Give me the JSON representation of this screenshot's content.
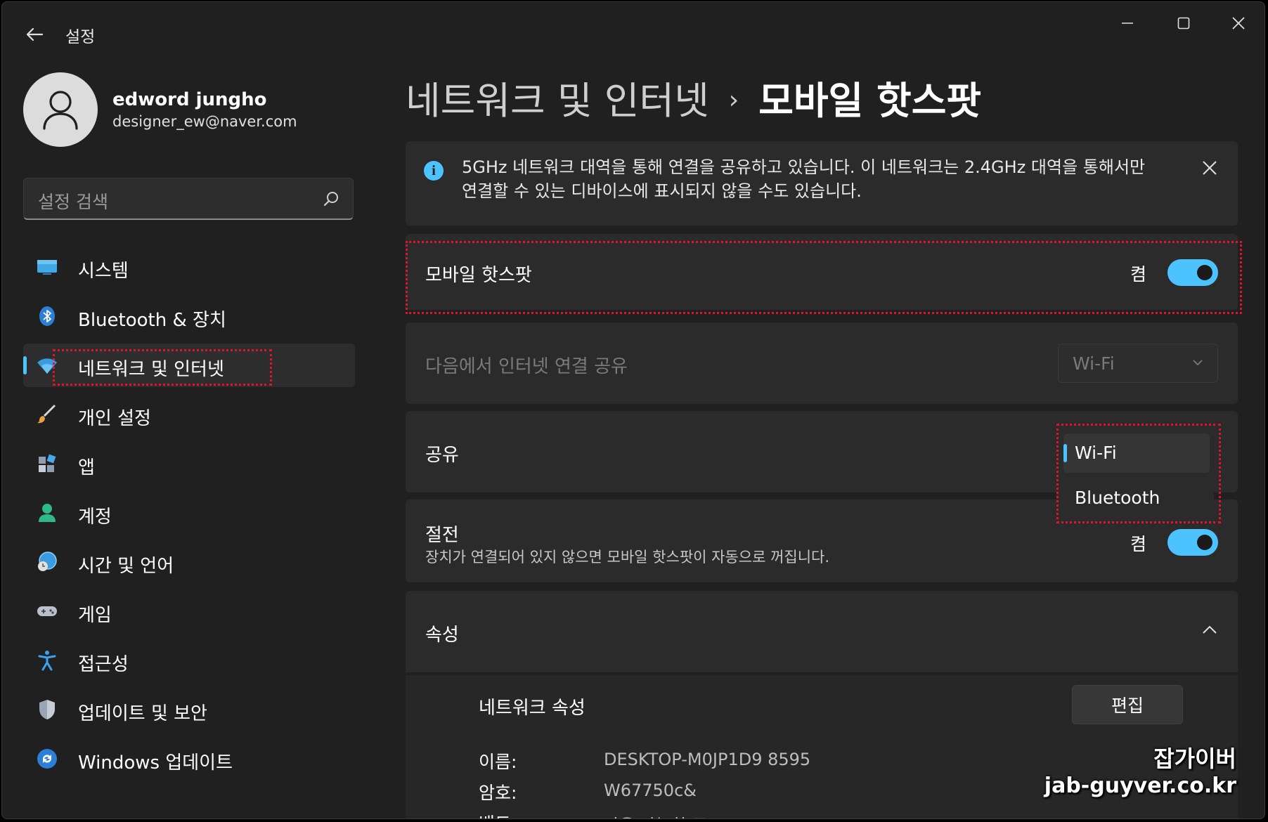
{
  "window": {
    "title": "설정"
  },
  "profile": {
    "name": "edword jungho",
    "email": "designer_ew@naver.com"
  },
  "search": {
    "placeholder": "설정 검색"
  },
  "nav": {
    "items": [
      {
        "label": "시스템",
        "icon": "monitor-icon"
      },
      {
        "label": "Bluetooth & 장치",
        "icon": "bluetooth-icon"
      },
      {
        "label": "네트워크 및 인터넷",
        "icon": "wifi-icon",
        "active": true
      },
      {
        "label": "개인 설정",
        "icon": "brush-icon"
      },
      {
        "label": "앱",
        "icon": "apps-icon"
      },
      {
        "label": "계정",
        "icon": "person-icon"
      },
      {
        "label": "시간 및 언어",
        "icon": "globe-clock-icon"
      },
      {
        "label": "게임",
        "icon": "gamepad-icon"
      },
      {
        "label": "접근성",
        "icon": "accessibility-icon"
      },
      {
        "label": "업데이트 및 보안",
        "icon": "shield-icon"
      },
      {
        "label": "Windows 업데이트",
        "icon": "refresh-icon"
      }
    ]
  },
  "breadcrumb": {
    "parent": "네트워크 및 인터넷",
    "separator": "›",
    "current": "모바일 핫스팟"
  },
  "infobar": {
    "text": "5GHz 네트워크 대역을 통해 연결을 공유하고 있습니다. 이 네트워크는 2.4GHz 대역을 통해서만 연결할 수 있는 디바이스에 표시되지 않을 수도 있습니다."
  },
  "hotspot": {
    "label": "모바일 핫스팟",
    "state": "켬",
    "on": true
  },
  "share_from": {
    "label": "다음에서 인터넷 연결 공유",
    "value": "Wi-Fi"
  },
  "share_over": {
    "label": "공유",
    "options": [
      "Wi-Fi",
      "Bluetooth"
    ],
    "selected": "Wi-Fi"
  },
  "power_saving": {
    "label": "절전",
    "description": "장치가 연결되어 있지 않으면 모바일 핫스팟이 자동으로 꺼집니다.",
    "state": "켬",
    "on": true
  },
  "properties": {
    "label": "속성",
    "network_props_label": "네트워크 속성",
    "edit_label": "편집",
    "rows": [
      {
        "key": "이름:",
        "value": "DESKTOP-M0JP1D9 8595"
      },
      {
        "key": "암호:",
        "value": "W67750c&"
      },
      {
        "key": "밴드:",
        "value": "사용 가능한 모드"
      }
    ]
  },
  "watermark": {
    "line1": "잡가이버",
    "line2": "jab-guyver.co.kr"
  },
  "colors": {
    "accent": "#4cc2ff",
    "highlight_marker": "#e0142b",
    "background": "#202020",
    "card": "#2b2b2b"
  }
}
